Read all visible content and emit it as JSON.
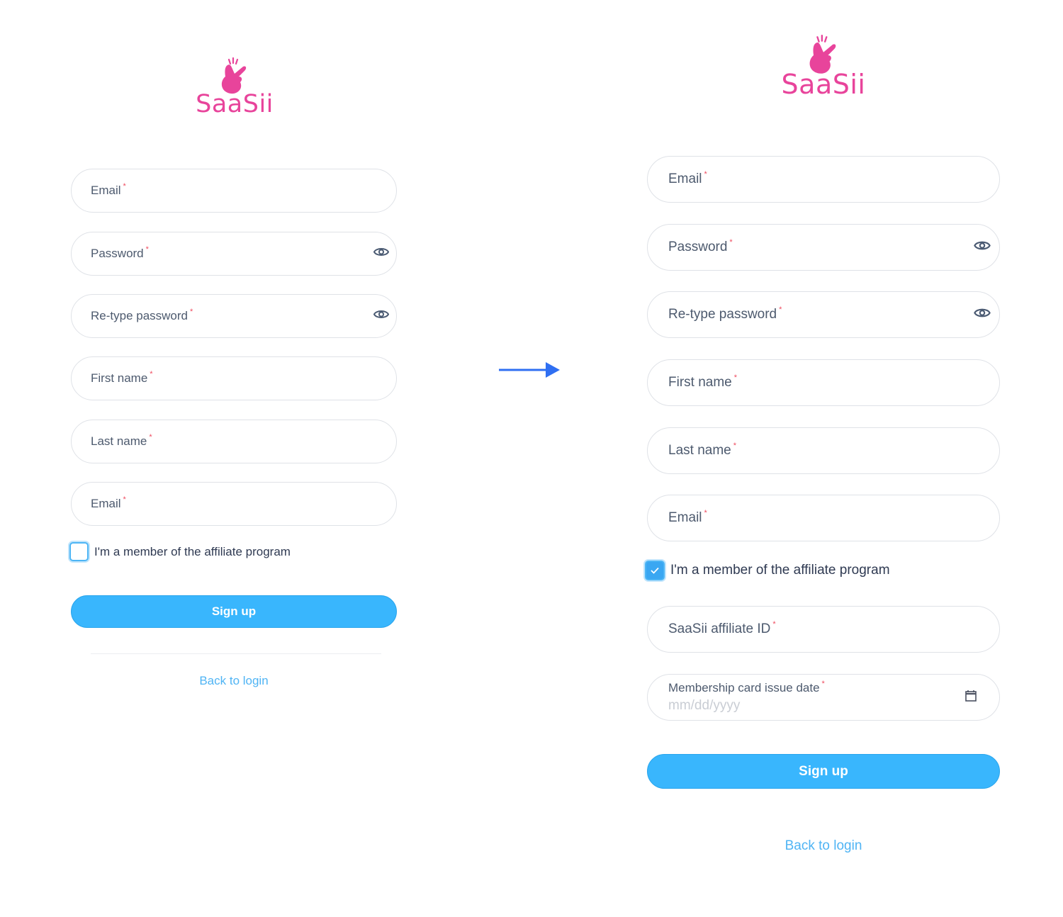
{
  "brand": {
    "name": "SaaSii",
    "color": "#e8449b",
    "logo_icon": "snapping-hand-icon"
  },
  "colors": {
    "accent": "#39b6fd",
    "link": "#4fb4f4",
    "required": "#ef4b5f",
    "arrow": "#2f6ff2"
  },
  "before": {
    "fields": [
      {
        "label": "Email",
        "required": "*"
      },
      {
        "label": "Password",
        "required": "*",
        "icon": "eye-icon"
      },
      {
        "label": "Re-type password",
        "required": "*",
        "icon": "eye-icon"
      },
      {
        "label": "First name",
        "required": "*"
      },
      {
        "label": "Last name",
        "required": "*"
      },
      {
        "label": "Email",
        "required": "*"
      }
    ],
    "affiliate_checkbox": {
      "label": "I'm a member of the affiliate program",
      "checked": false
    },
    "signup_label": "Sign up",
    "back_label": "Back to login"
  },
  "transition": {
    "icon": "arrow-right-icon"
  },
  "after": {
    "fields": [
      {
        "label": "Email",
        "required": "*"
      },
      {
        "label": "Password",
        "required": "*",
        "icon": "eye-icon"
      },
      {
        "label": "Re-type password",
        "required": "*",
        "icon": "eye-icon"
      },
      {
        "label": "First name",
        "required": "*"
      },
      {
        "label": "Last name",
        "required": "*"
      },
      {
        "label": "Email",
        "required": "*"
      }
    ],
    "affiliate_checkbox": {
      "label": "I'm a member of the affiliate program",
      "checked": true
    },
    "affiliate_id": {
      "label": "SaaSii affiliate ID",
      "required": "*"
    },
    "issue_date": {
      "label": "Membership card issue date",
      "required": "*",
      "placeholder": "mm/dd/yyyy",
      "icon": "calendar-icon"
    },
    "signup_label": "Sign up",
    "back_label": "Back to login"
  }
}
